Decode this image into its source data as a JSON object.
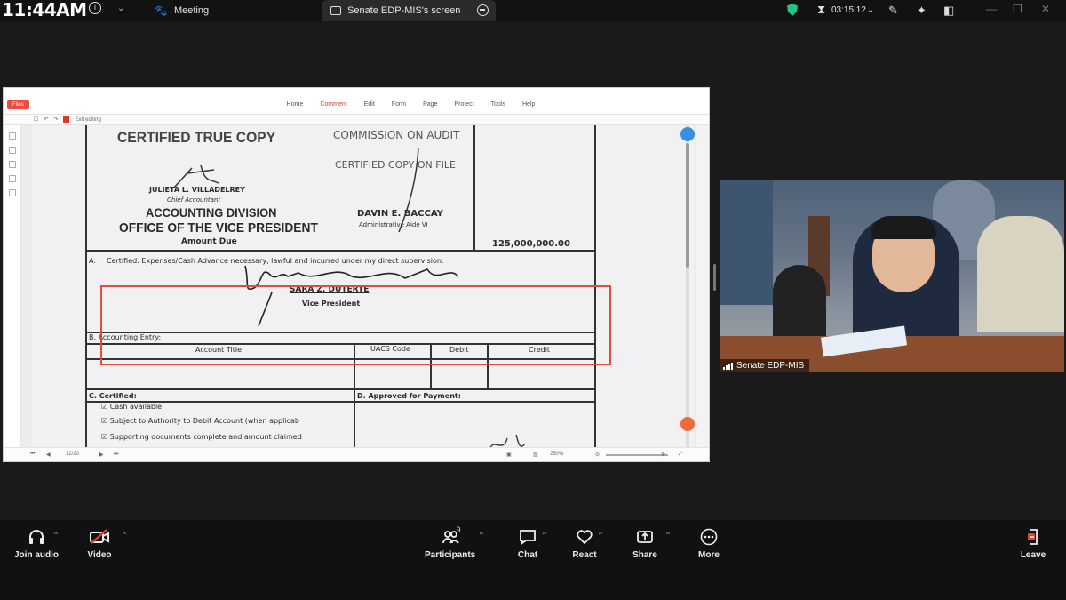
{
  "topbar": {
    "clock": "11:44AM",
    "tabs": [
      {
        "label": "Meeting",
        "icon": "paw-icon"
      },
      {
        "label": "Senate EDP-MIS's screen",
        "icon": "screen-share-icon"
      }
    ],
    "timer": "03:15:12",
    "accent_shield": "#23c483"
  },
  "document_window": {
    "menu": [
      "Home",
      "Comment",
      "Edit",
      "Form",
      "Page",
      "Protect",
      "Tools",
      "Help"
    ],
    "active_menu": "Comment",
    "files_label": "Files",
    "toolbar_edit_label": "Exit editing",
    "page_indicator": "12/20",
    "zoom": "250%",
    "highlight_color": "#e34b3a",
    "doc": {
      "certified_true_copy": "CERTIFIED TRUE COPY",
      "commission_on_audit": "COMMISSION ON AUDIT",
      "certified_copy_on_file": "CERTIFIED COPY ON FILE",
      "signatory_1_name": "JULIETA L. VILLADELREY",
      "signatory_1_title": "Chief Accountant",
      "accounting_division": "ACCOUNTING DIVISION",
      "ovp": "OFFICE OF THE VICE PRESIDENT",
      "signatory_2_name": "DAVIN E. BACCAY",
      "signatory_2_title": "Administrative Aide VI",
      "amount_due_label": "Amount Due",
      "amount_due_value": "125,000,000.00",
      "section_a_letter": "A.",
      "section_a_text": "Certified:  Expenses/Cash Advance necessary,  lawful and  incurred under my direct supervision.",
      "vp_name": "SARA Z. DUTERTE",
      "vp_title": "Vice President",
      "section_b": "B.  Accounting Entry:",
      "col_account_title": "Account Title",
      "col_uacs": "UACS Code",
      "col_debit": "Debit",
      "col_credit": "Credit",
      "section_c": "C. Certified:",
      "section_d": "D. Approved for Payment:",
      "check_1": "Cash available",
      "check_2": "Subject to Authority to Debit Account (when applicab",
      "check_3": "Supporting documents complete and amount claimed"
    }
  },
  "video_tile": {
    "label": "Senate EDP-MIS"
  },
  "bottom_toolbar": {
    "join_audio": "Join audio",
    "video": "Video",
    "participants": "Participants",
    "participants_count": "9",
    "chat": "Chat",
    "react": "React",
    "share": "Share",
    "more": "More",
    "leave": "Leave"
  }
}
